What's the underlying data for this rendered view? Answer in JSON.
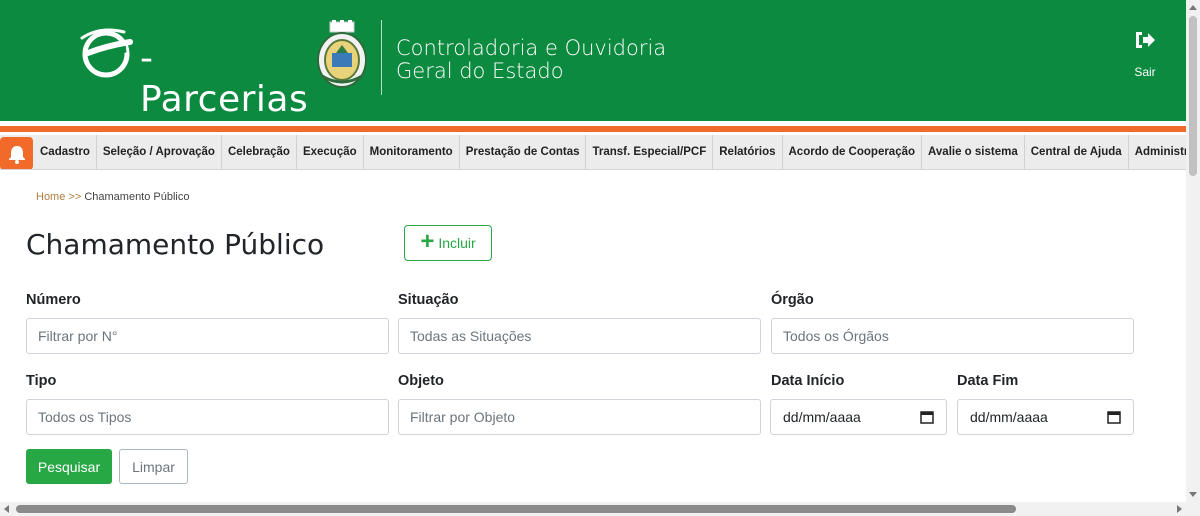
{
  "header": {
    "logo_text": "-Parcerias",
    "org_line1": "Controladoria e Ouvidoria",
    "org_line2": "Geral do Estado",
    "logout_label": "Sair"
  },
  "colors": {
    "header_green": "#0c8a3f",
    "accent_orange": "#f26a2a",
    "button_green": "#28a745",
    "breadcrumb_link": "#b07d3e"
  },
  "icons": {
    "logout": "sign-out-icon",
    "notifications": "bell-icon",
    "include": "plus-icon",
    "calendar": "calendar-icon"
  },
  "menu": {
    "items": [
      {
        "label": "Cadastro"
      },
      {
        "label": "Seleção / Aprovação"
      },
      {
        "label": "Celebração"
      },
      {
        "label": "Execução"
      },
      {
        "label": "Monitoramento"
      },
      {
        "label": "Prestação de Contas"
      },
      {
        "label": "Transf. Especial/PCF"
      },
      {
        "label": "Relatórios"
      },
      {
        "label": "Acordo de Cooperação"
      },
      {
        "label": "Avalie o sistema"
      },
      {
        "label": "Central de Ajuda"
      },
      {
        "label": "Administração"
      }
    ]
  },
  "breadcrumb": {
    "home": "Home",
    "separator": ">>",
    "current": "Chamamento Público"
  },
  "page": {
    "title": "Chamamento Público",
    "include_label": "Incluir"
  },
  "filters": {
    "numero": {
      "label": "Número",
      "placeholder": "Filtrar por N°"
    },
    "situacao": {
      "label": "Situação",
      "placeholder": "Todas as Situações"
    },
    "orgao": {
      "label": "Órgão",
      "placeholder": "Todos os Órgãos"
    },
    "tipo": {
      "label": "Tipo",
      "placeholder": "Todos os Tipos"
    },
    "objeto": {
      "label": "Objeto",
      "placeholder": "Filtrar por Objeto"
    },
    "data_inicio": {
      "label": "Data Início",
      "value": "dd/mm/aaaa"
    },
    "data_fim": {
      "label": "Data Fim",
      "value": "dd/mm/aaaa"
    }
  },
  "actions": {
    "search_label": "Pesquisar",
    "clear_label": "Limpar"
  }
}
